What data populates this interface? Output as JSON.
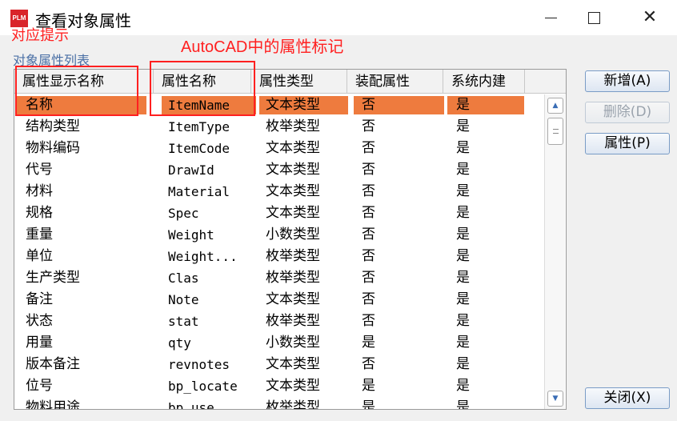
{
  "window": {
    "icon_text": "PLM",
    "title": "查看对象属性"
  },
  "annotations": {
    "left": "对应提示",
    "right": "AutoCAD中的属性标记"
  },
  "list_label": "对象属性列表",
  "columns": [
    "属性显示名称",
    "属性名称",
    "属性类型",
    "装配属性",
    "系统内建"
  ],
  "rows": [
    [
      "名称",
      "ItemName",
      "文本类型",
      "否",
      "是"
    ],
    [
      "结构类型",
      "ItemType",
      "枚举类型",
      "否",
      "是"
    ],
    [
      "物料编码",
      "ItemCode",
      "文本类型",
      "否",
      "是"
    ],
    [
      "代号",
      "DrawId",
      "文本类型",
      "否",
      "是"
    ],
    [
      "材料",
      "Material",
      "文本类型",
      "否",
      "是"
    ],
    [
      "规格",
      "Spec",
      "文本类型",
      "否",
      "是"
    ],
    [
      "重量",
      "Weight",
      "小数类型",
      "否",
      "是"
    ],
    [
      "单位",
      "Weight...",
      "枚举类型",
      "否",
      "是"
    ],
    [
      "生产类型",
      "Clas",
      "枚举类型",
      "否",
      "是"
    ],
    [
      "备注",
      "Note",
      "文本类型",
      "否",
      "是"
    ],
    [
      "状态",
      "stat",
      "枚举类型",
      "否",
      "是"
    ],
    [
      "用量",
      "qty",
      "小数类型",
      "是",
      "是"
    ],
    [
      "版本备注",
      "revnotes",
      "文本类型",
      "否",
      "是"
    ],
    [
      "位号",
      "bp_locate",
      "文本类型",
      "是",
      "是"
    ],
    [
      "物料用途",
      "bp_use",
      "枚举类型",
      "是",
      "是"
    ]
  ],
  "selected_row": 0,
  "buttons": {
    "new": "新增(A)",
    "delete": "删除(D)",
    "properties": "属性(P)",
    "close": "关闭(X)"
  },
  "colors": {
    "selection": "#ee7b3e",
    "annotation": "#ff2020",
    "app_icon": "#d9242a"
  }
}
